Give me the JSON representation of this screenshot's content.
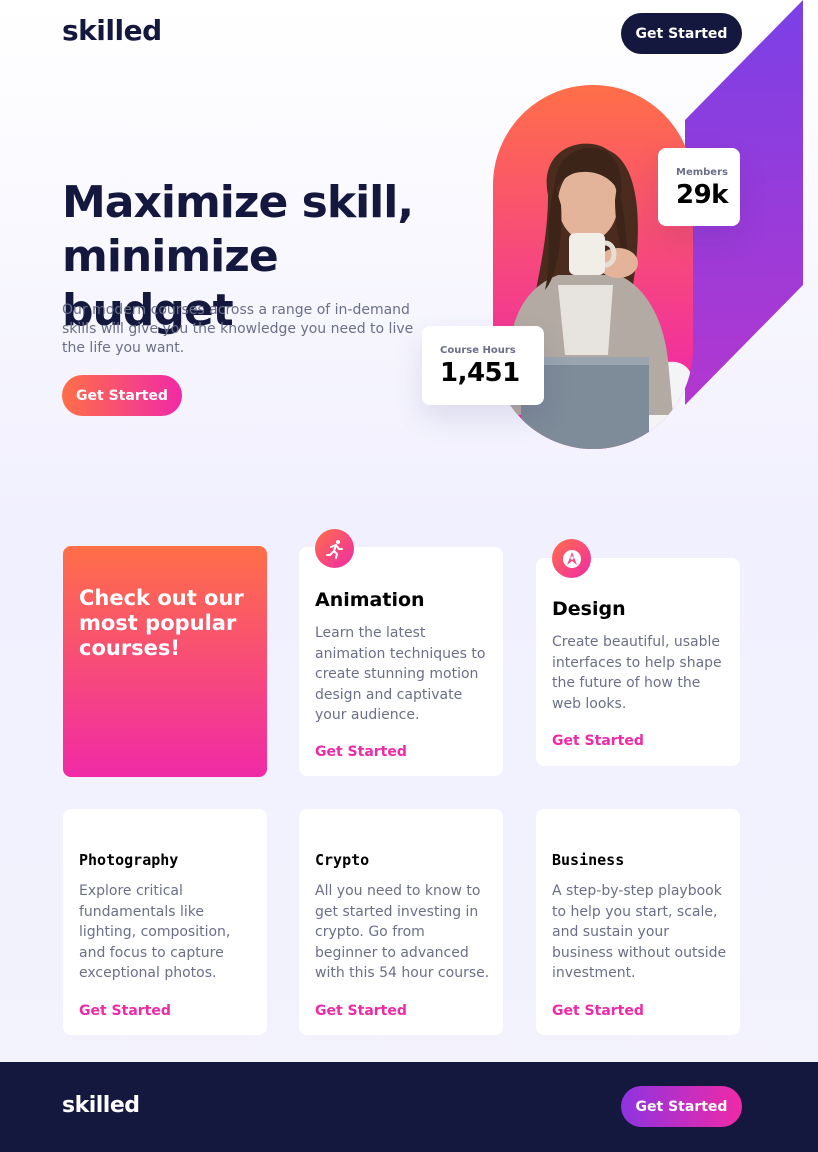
{
  "brand": {
    "logo": "skilled"
  },
  "header": {
    "cta_label": "Get Started"
  },
  "hero": {
    "title": "Maximize skill, minimize budget",
    "description": "Our modern courses across a range of in-demand skills will give you the knowledge you need to live the life you want.",
    "cta_label": "Get Started",
    "photo_alt": "woman-drinking-coffee"
  },
  "stats": {
    "members": {
      "label": "Members",
      "value": "29k"
    },
    "course_hours": {
      "label": "Course Hours",
      "value": "1,451"
    }
  },
  "courses": {
    "promo_text": "Check out our most popular courses!",
    "items": [
      {
        "title": "Animation",
        "description": "Learn the latest animation techniques to create stunning motion design and captivate your audience.",
        "link": "Get Started",
        "icon": "running-figure-icon"
      },
      {
        "title": "Design",
        "description": "Create beautiful, usable interfaces to help shape the future of how the web looks.",
        "link": "Get Started",
        "icon": "design-tool-icon"
      },
      {
        "title": "Photography",
        "description": "Explore critical fundamentals like lighting, composition, and focus to capture exceptional photos.",
        "link": "Get Started"
      },
      {
        "title": "Crypto",
        "description": "All you need to know to get started investing in crypto. Go from beginner to advanced with this 54 hour course.",
        "link": "Get Started"
      },
      {
        "title": "Business",
        "description": "A step-by-step playbook to help you start, scale, and sustain your business without outside investment.",
        "link": "Get Started"
      }
    ]
  },
  "footer": {
    "logo": "skilled",
    "cta_label": "Get Started"
  },
  "colors": {
    "navy": "#14183e",
    "orange": "#ff6f48",
    "pink": "#f02aa6",
    "purple": "#8e33e0",
    "gray_text": "#6b6f88"
  }
}
